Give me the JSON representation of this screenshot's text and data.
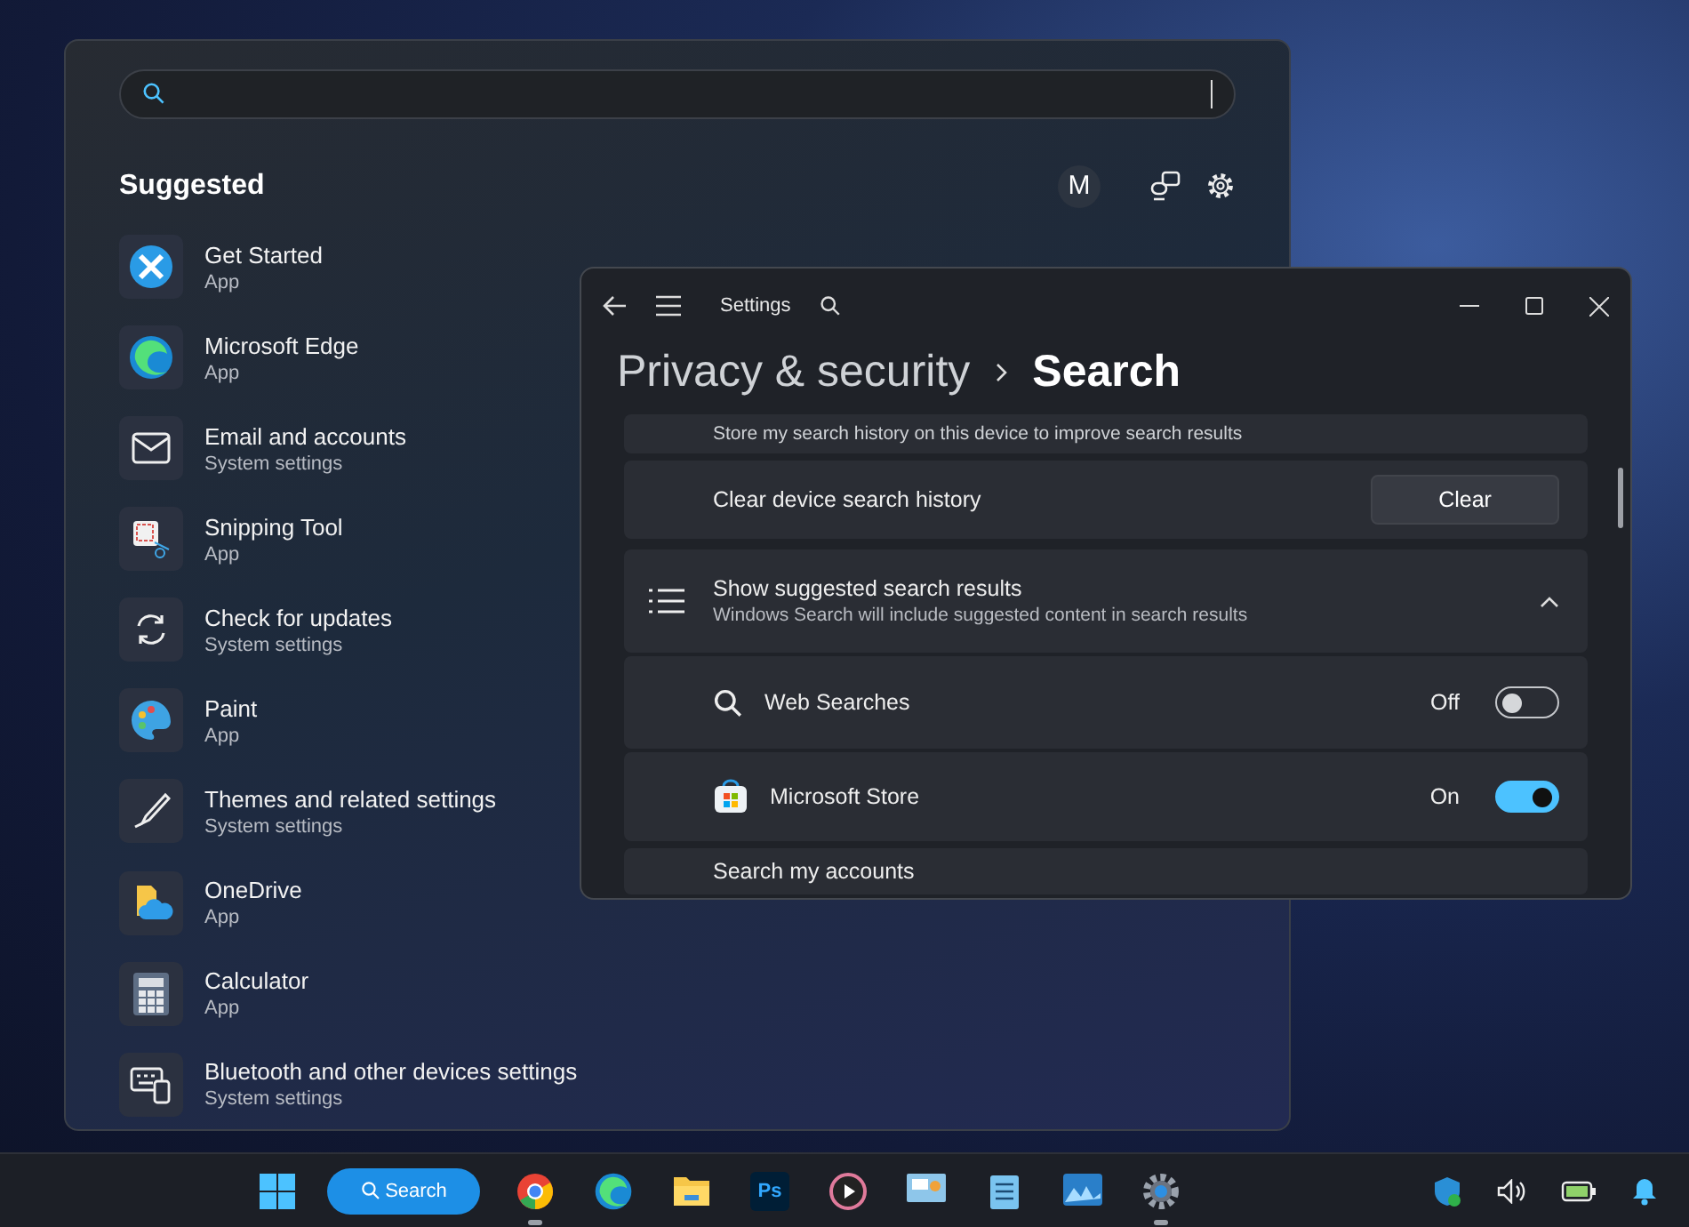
{
  "search_panel": {
    "title": "Suggested",
    "account": "M",
    "items": [
      {
        "kind": "get-started",
        "name": "Get Started",
        "type": "App"
      },
      {
        "kind": "edge",
        "name": "Microsoft Edge",
        "type": "App"
      },
      {
        "kind": "mail",
        "name": "Email and accounts",
        "type": "System settings"
      },
      {
        "kind": "snipping",
        "name": "Snipping Tool",
        "type": "App"
      },
      {
        "kind": "updates",
        "name": "Check for updates",
        "type": "System settings"
      },
      {
        "kind": "paint",
        "name": "Paint",
        "type": "App"
      },
      {
        "kind": "brush",
        "name": "Themes and related settings",
        "type": "System settings"
      },
      {
        "kind": "onedrive",
        "name": "OneDrive",
        "type": "App"
      },
      {
        "kind": "calculator",
        "name": "Calculator",
        "type": "App"
      },
      {
        "kind": "bluetooth",
        "name": "Bluetooth and other devices settings",
        "type": "System settings"
      }
    ]
  },
  "settings_window": {
    "title": "Settings",
    "breadcrumb": [
      "Privacy & security",
      "Search"
    ],
    "rows": [
      {
        "kind": "text",
        "label": "Store my search history on this device to improve search results"
      },
      {
        "kind": "button",
        "label": "Clear device search history",
        "button": "Clear"
      },
      {
        "kind": "expander",
        "label": "Show suggested search results",
        "description": "Windows Search will include suggested content in search results",
        "expanded": true
      },
      {
        "kind": "search-toggle",
        "label": "Web Searches",
        "state": "Off",
        "on": false
      },
      {
        "kind": "store-toggle",
        "label": "Microsoft Store",
        "state": "On",
        "on": true
      },
      {
        "kind": "text",
        "label": "Search my accounts"
      }
    ]
  },
  "taskbar": {
    "search_button": "Search",
    "apps": [
      {
        "kind": "chrome",
        "running": true
      },
      {
        "kind": "edge",
        "running": false
      },
      {
        "kind": "folder",
        "running": false
      },
      {
        "kind": "photoshop",
        "label": "Ps",
        "running": false
      },
      {
        "kind": "player",
        "running": false
      },
      {
        "kind": "slides",
        "running": false
      },
      {
        "kind": "notepad",
        "running": false
      },
      {
        "kind": "photos",
        "running": false
      },
      {
        "kind": "settings",
        "running": true
      }
    ]
  }
}
